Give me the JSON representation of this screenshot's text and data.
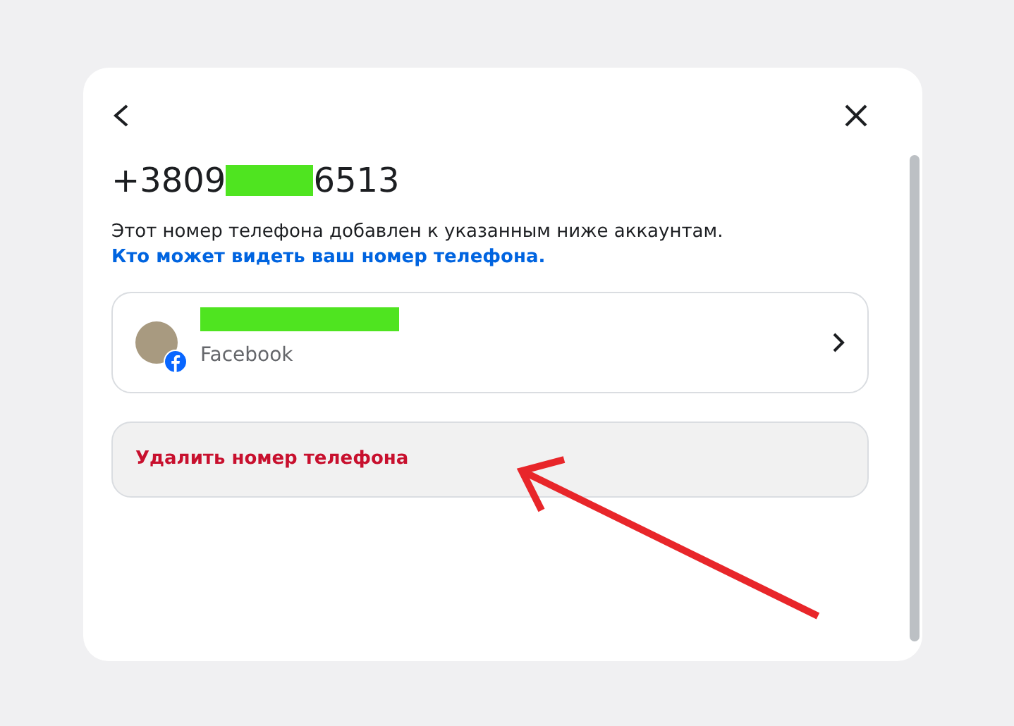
{
  "dialog": {
    "phone": {
      "prefix": "+3809",
      "suffix": "6513"
    },
    "description": "Этот номер телефона добавлен к указанным ниже аккаунтам.",
    "help_link": "Кто может видеть ваш номер телефона.",
    "accounts": [
      {
        "platform": "Facebook"
      }
    ],
    "delete_button": "Удалить номер телефона"
  }
}
